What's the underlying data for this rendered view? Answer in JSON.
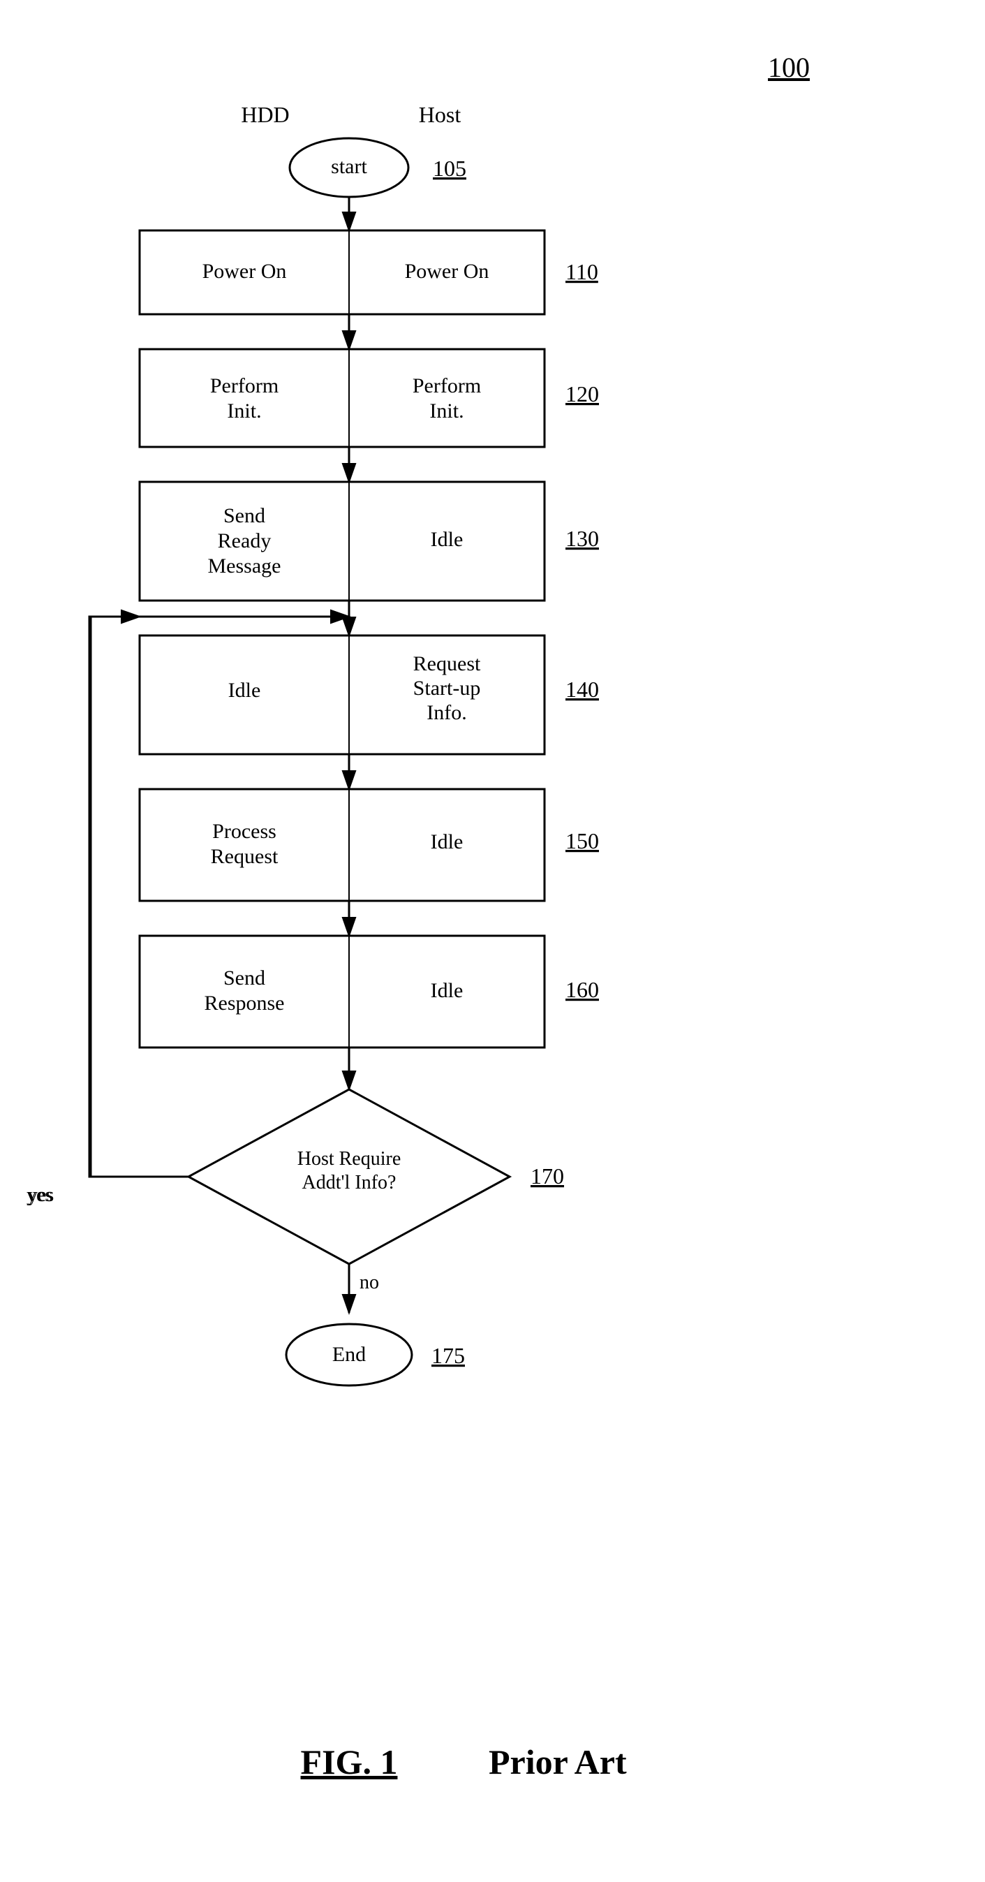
{
  "diagram": {
    "number": "100",
    "fig_label": "FIG. 1",
    "fig_sublabel": "Prior Art",
    "nodes": {
      "start": {
        "label": "start",
        "ref": "105"
      },
      "n110": {
        "hdd": "Power On",
        "host": "Power On",
        "ref": "110"
      },
      "n120": {
        "hdd": "Perform\nInit.",
        "host": "Perform\nInit.",
        "ref": "120"
      },
      "n130": {
        "hdd": "Send\nReady\nMessage",
        "host": "Idle",
        "ref": "130"
      },
      "n140": {
        "hdd": "Idle",
        "host": "Request\nStart-up\nInfo.",
        "ref": "140"
      },
      "n150": {
        "hdd": "Process\nRequest",
        "host": "Idle",
        "ref": "150"
      },
      "n160": {
        "hdd": "Send\nResponse",
        "host": "Idle",
        "ref": "160"
      },
      "n170": {
        "label": "Host Require\nAddt'l Info?",
        "ref": "170",
        "yes": "yes",
        "no": "no"
      },
      "end": {
        "label": "End",
        "ref": "175"
      }
    },
    "col_labels": {
      "hdd": "HDD",
      "host": "Host"
    }
  }
}
